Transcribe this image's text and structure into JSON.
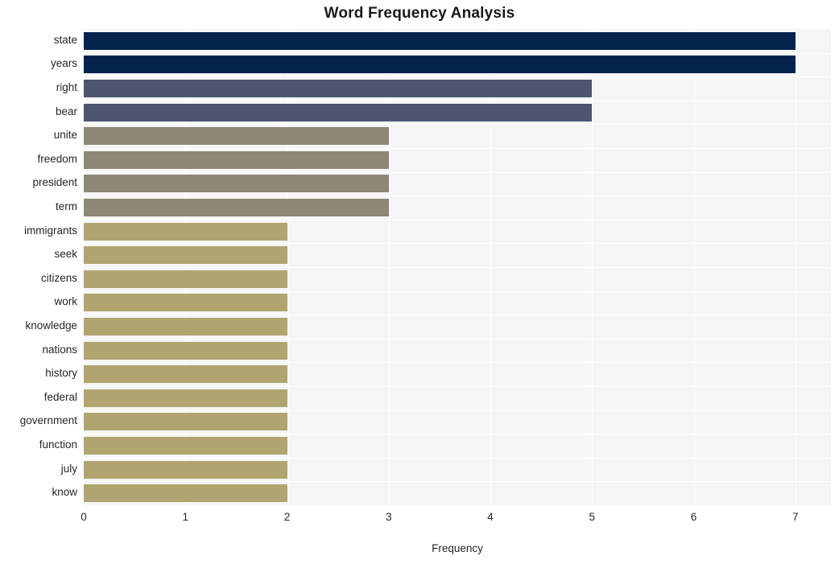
{
  "chart_data": {
    "type": "bar",
    "orientation": "horizontal",
    "title": "Word Frequency Analysis",
    "xlabel": "Frequency",
    "ylabel": "",
    "xlim": [
      0,
      7.35
    ],
    "xticks": [
      "0",
      "1",
      "2",
      "3",
      "4",
      "5",
      "6",
      "7"
    ],
    "xtick_values": [
      0,
      1,
      2,
      3,
      4,
      5,
      6,
      7
    ],
    "grid": true,
    "legend": null,
    "categories": [
      "state",
      "years",
      "right",
      "bear",
      "unite",
      "freedom",
      "president",
      "term",
      "immigrants",
      "seek",
      "citizens",
      "work",
      "knowledge",
      "nations",
      "history",
      "federal",
      "government",
      "function",
      "july",
      "know"
    ],
    "values": [
      7,
      7,
      5,
      5,
      3,
      3,
      3,
      3,
      2,
      2,
      2,
      2,
      2,
      2,
      2,
      2,
      2,
      2,
      2,
      2
    ],
    "bar_colors": [
      "#03224c",
      "#03224c",
      "#4d5571",
      "#4d5571",
      "#8d8878",
      "#8d8878",
      "#8d8878",
      "#8d8878",
      "#b0a56f",
      "#b0a56f",
      "#b0a56f",
      "#b0a56f",
      "#b0a56f",
      "#b0a56f",
      "#b0a56f",
      "#b0a56f",
      "#b0a56f",
      "#b0a56f",
      "#b0a56f",
      "#b0a56f"
    ],
    "palette": {
      "tier_7": "#03224c",
      "tier_5": "#4d5571",
      "tier_3": "#8d8878",
      "tier_2": "#b0a56f"
    },
    "style": {
      "plot_background": "#f6f6f7",
      "grid_color": "#ffffff",
      "figure_background": "#ffffff",
      "text_color": "#262626"
    }
  }
}
